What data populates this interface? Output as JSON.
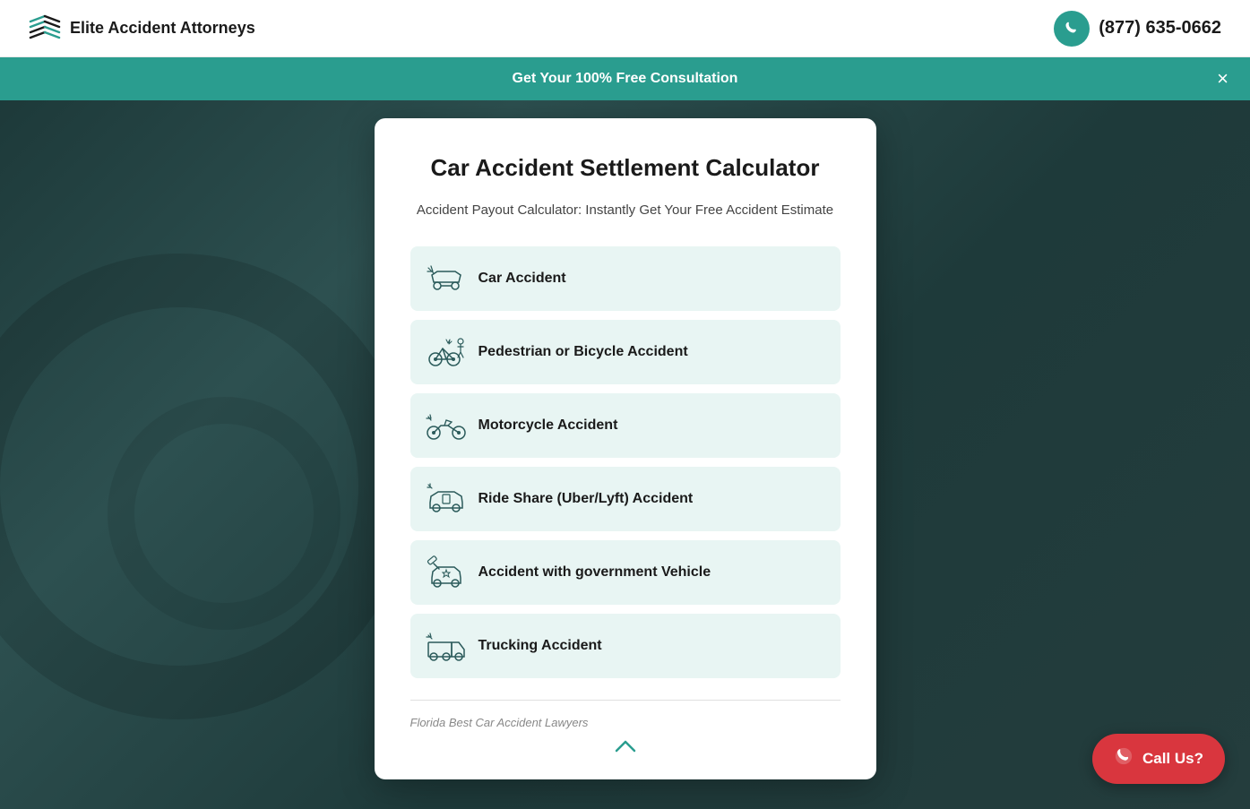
{
  "header": {
    "logo_text": "Elite Accident Attorneys",
    "phone_number": "(877) 635-0662"
  },
  "banner": {
    "text": "Get Your 100% Free Consultation",
    "close_label": "×"
  },
  "modal": {
    "title": "Car Accident Settlement Calculator",
    "subtitle": "Accident Payout Calculator: Instantly Get Your Free Accident Estimate",
    "options": [
      {
        "id": "car-accident",
        "label": "Car Accident"
      },
      {
        "id": "pedestrian-bicycle",
        "label": "Pedestrian or Bicycle Accident"
      },
      {
        "id": "motorcycle",
        "label": "Motorcycle Accident"
      },
      {
        "id": "rideshare",
        "label": "Ride Share (Uber/Lyft) Accident"
      },
      {
        "id": "government-vehicle",
        "label": "Accident with government Vehicle"
      },
      {
        "id": "trucking",
        "label": "Trucking Accident"
      }
    ],
    "footer_text": "Florida Best Car Accident Lawyers"
  },
  "call_button": {
    "label": "Call Us?"
  }
}
